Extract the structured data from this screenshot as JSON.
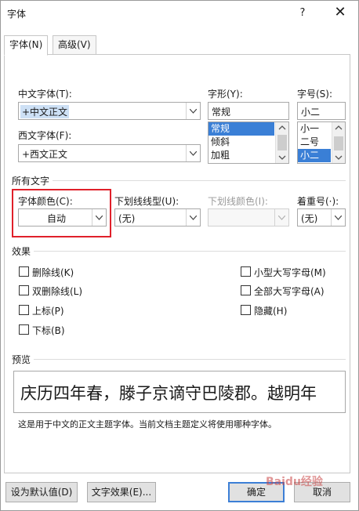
{
  "window": {
    "title": "字体",
    "help_label": "?",
    "close_label": "✕"
  },
  "tabs": [
    {
      "label": "字体(N)",
      "active": true
    },
    {
      "label": "高级(V)",
      "active": false
    }
  ],
  "font": {
    "chinese_label": "中文字体(T):",
    "chinese_value": "+中文正文",
    "western_label": "西文字体(F):",
    "western_value": "+西文正文",
    "style_label": "字形(Y):",
    "style_value": "常规",
    "style_options": [
      "常规",
      "倾斜",
      "加粗"
    ],
    "style_selected": "常规",
    "size_label": "字号(S):",
    "size_value": "小二",
    "size_options": [
      "小一",
      "二号",
      "小二"
    ],
    "size_selected": "小二"
  },
  "all_text": {
    "section_label": "所有文字",
    "color_label": "字体颜色(C):",
    "color_value": "自动",
    "underline_label": "下划线线型(U):",
    "underline_value": "(无)",
    "underline_color_label": "下划线颜色(I):",
    "underline_color_value": "",
    "emphasis_label": "着重号(·):",
    "emphasis_value": "(无)"
  },
  "effects": {
    "section_label": "效果",
    "left": [
      "删除线(K)",
      "双删除线(L)",
      "上标(P)",
      "下标(B)"
    ],
    "right": [
      "小型大写字母(M)",
      "全部大写字母(A)",
      "隐藏(H)"
    ]
  },
  "preview": {
    "section_label": "预览",
    "sample_text": "庆历四年春，滕子京谪守巴陵郡。越明年",
    "note": "这是用于中文的正文主题字体。当前文档主题定义将使用哪种字体。"
  },
  "buttons": {
    "set_default": "设为默认值(D)",
    "text_effects": "文字效果(E)...",
    "ok": "确定",
    "cancel": "取消"
  },
  "watermark": "Baidu经验",
  "colors": {
    "highlight": "#e0202a",
    "selection": "#3a7fd6",
    "accent_border": "#3c7fd6"
  }
}
